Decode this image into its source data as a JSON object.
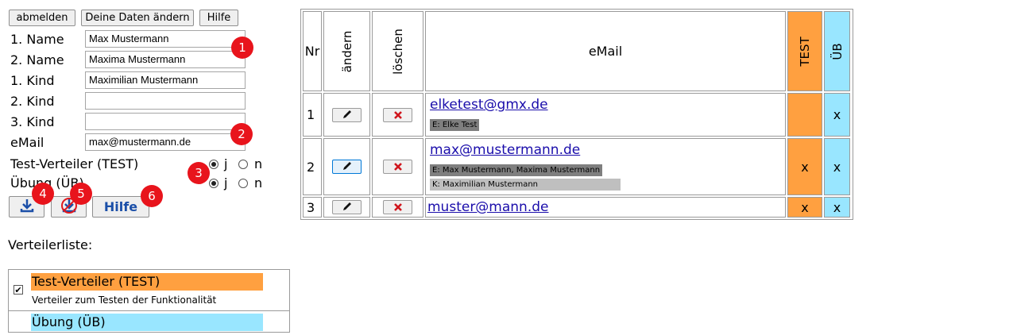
{
  "toolbar": {
    "logout_label": "abmelden",
    "edit_data_label": "Deine Daten ändern",
    "help_label": "Hilfe"
  },
  "form": {
    "fields": [
      {
        "label": "1. Name",
        "value": "Max Mustermann"
      },
      {
        "label": "2. Name",
        "value": "Maxima Mustermann"
      },
      {
        "label": "1. Kind",
        "value": "Maximilian Mustermann"
      },
      {
        "label": "2. Kind",
        "value": ""
      },
      {
        "label": "3. Kind",
        "value": ""
      },
      {
        "label": "eMail",
        "value": "max@mustermann.de"
      }
    ],
    "lists": [
      {
        "label": "Test-Verteiler (TEST)",
        "selected": "j"
      },
      {
        "label": "Übung (ÜB)",
        "selected": "j"
      }
    ],
    "radio_yes": "j",
    "radio_no": "n"
  },
  "actions": {
    "save_icon": "download-icon",
    "delete_icon": "delete-download-icon",
    "help_label": "Hilfe"
  },
  "badges": [
    "1",
    "2",
    "3",
    "4",
    "5",
    "6"
  ],
  "distribution": {
    "heading": "Verteilerliste:",
    "items": [
      {
        "name": "Test-Verteiler (TEST)",
        "description": "Verteiler zum Testen der Funktionalität",
        "color": "#ffa040",
        "checked": true
      },
      {
        "name": "Übung (ÜB)",
        "description": "",
        "color": "#99e6ff",
        "checked": false
      }
    ]
  },
  "table": {
    "headers": {
      "nr": "Nr",
      "edit": "ändern",
      "delete": "löschen",
      "email": "eMail",
      "test": "TEST",
      "ub": "ÜB"
    },
    "colors": {
      "test": "#ffa040",
      "ub": "#99e6ff"
    },
    "rows": [
      {
        "nr": "1",
        "email": "elketest@gmx.de",
        "tags": [
          {
            "text": "E: Elke Test",
            "style": "dark"
          }
        ],
        "test": "",
        "ub": "x"
      },
      {
        "nr": "2",
        "email": "max@mustermann.de",
        "tags": [
          {
            "text": "E: Max Mustermann, Maxima Mustermann",
            "style": "dark"
          },
          {
            "text": "K: Maximilian Mustermann",
            "style": "light"
          }
        ],
        "test": "x",
        "ub": "x"
      },
      {
        "nr": "3",
        "email": "muster@mann.de",
        "tags": [],
        "test": "x",
        "ub": "x"
      }
    ]
  }
}
